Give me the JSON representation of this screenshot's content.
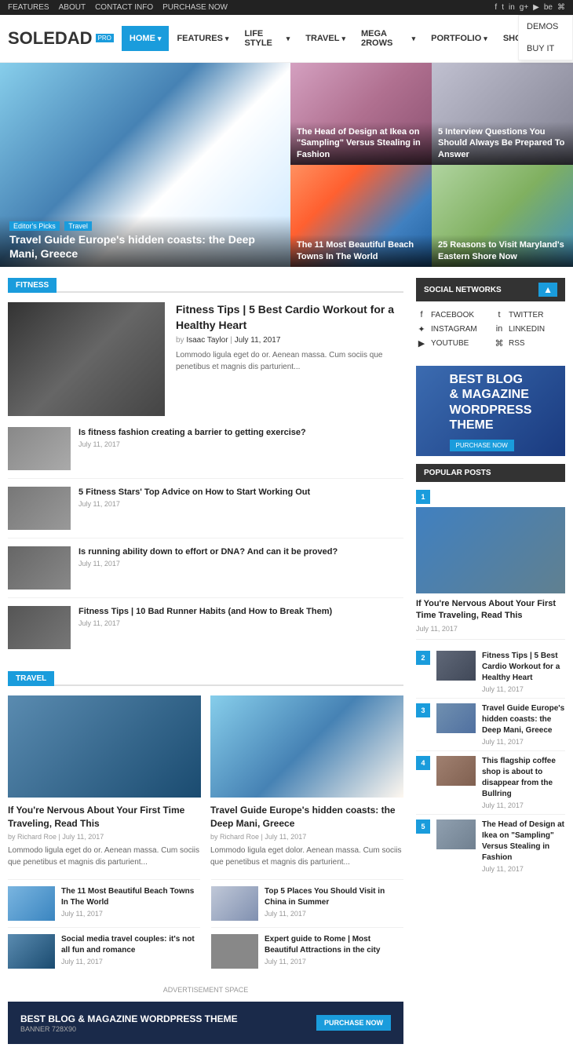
{
  "topbar": {
    "links": [
      "FEATURES",
      "ABOUT",
      "CONTACT INFO",
      "PURCHASE NOW"
    ],
    "social_icons": [
      "f",
      "t",
      "in",
      "g+",
      "y",
      "be",
      "rss"
    ]
  },
  "header": {
    "logo": "SOLEDAD",
    "logo_badge": "PRO",
    "nav_items": [
      "HOME",
      "FEATURES",
      "LIFE STYLE",
      "TRAVEL",
      "MEGA 2ROWS",
      "PORTFOLIO",
      "SHOP"
    ],
    "dropdown": [
      "DEMOS",
      "BUY IT"
    ]
  },
  "hero": {
    "main": {
      "tag1": "Editor's Picks",
      "tag2": "Travel",
      "title": "Travel Guide Europe's hidden coasts: the Deep Mani, Greece"
    },
    "cards": [
      {
        "title": "The Head of Design at Ikea on \"Sampling\" Versus Stealing in Fashion"
      },
      {
        "title": "5 Interview Questions You Should Always Be Prepared To Answer"
      },
      {
        "title": "The 11 Most Beautiful Beach Towns In The World"
      },
      {
        "title": "25 Reasons to Visit Maryland's Eastern Shore Now"
      }
    ]
  },
  "fitness": {
    "section_label": "FITNESS",
    "featured": {
      "title": "Fitness Tips | 5 Best Cardio Workout for a Healthy Heart",
      "author": "Isaac Taylor",
      "date": "July 11, 2017",
      "excerpt": "Lommodo ligula eget do or. Aenean massa. Cum sociis que penetibus et magnis dis parturient..."
    },
    "list": [
      {
        "title": "Is fitness fashion creating a barrier to getting exercise?",
        "date": "July 11, 2017"
      },
      {
        "title": "5 Fitness Stars' Top Advice on How to Start Working Out",
        "date": "July 11, 2017"
      },
      {
        "title": "Is running ability down to effort or DNA? And can it be proved?",
        "date": "July 11, 2017"
      },
      {
        "title": "Fitness Tips | 10 Bad Runner Habits (and How to Break Them)",
        "date": "July 11, 2017"
      }
    ]
  },
  "travel": {
    "section_label": "TRAVEL",
    "featured": [
      {
        "title": "If You're Nervous About Your First Time Traveling, Read This",
        "author": "Richard Roe",
        "date": "July 11, 2017",
        "excerpt": "Lommodo ligula eget do or. Aenean massa. Cum sociis que penetibus et magnis dis parturient..."
      },
      {
        "title": "Travel Guide Europe's hidden coasts: the Deep Mani, Greece",
        "author": "Richard Roe",
        "date": "July 11, 2017",
        "excerpt": "Lommodo ligula eget dolor. Aenean massa. Cum sociis que penetibus et magnis dis parturient..."
      }
    ],
    "list": [
      {
        "title": "The 11 Most Beautiful Beach Towns In The World",
        "date": "July 11, 2017"
      },
      {
        "title": "Top 5 Places You Should Visit in China in Summer",
        "date": "July 11, 2017"
      },
      {
        "title": "Social media travel couples: it's not all fun and romance",
        "date": "July 11, 2017"
      },
      {
        "title": "Expert guide to Rome | Most Beautiful Attractions in the city",
        "date": "July 11, 2017"
      }
    ]
  },
  "ad_banner": {
    "label": "ADVERTISEMENT SPACE",
    "title": "BEST BLOG & MAGAZINE WORDPRESS THEME",
    "sub": "BANNER 728X90",
    "button": "PURCHASE NOW"
  },
  "sidebar": {
    "social_title": "SOCIAL NETWORKS",
    "social_items": [
      {
        "icon": "f",
        "label": "FACEBOOK",
        "side": "left"
      },
      {
        "icon": "t",
        "label": "TWITTER",
        "side": "right"
      },
      {
        "icon": "in",
        "label": "INSTAGRAM",
        "side": "left"
      },
      {
        "icon": "li",
        "label": "LINKEDIN",
        "side": "right"
      },
      {
        "icon": "yt",
        "label": "YOUTUBE",
        "side": "left"
      },
      {
        "icon": "rss",
        "label": "RSS",
        "side": "right"
      }
    ],
    "sidebar_ad": {
      "line1": "BEST BLOG",
      "line2": "& MAGAZINE",
      "line3": "WORDPRESS",
      "line4": "THEME",
      "button": "PURCHASE NOW"
    },
    "popular_title": "POPULAR POSTS",
    "popular": [
      {
        "num": "1",
        "title": "If You're Nervous About Your First Time Traveling, Read This",
        "date": "July 11, 2017",
        "featured": true
      },
      {
        "num": "2",
        "title": "Fitness Tips | 5 Best Cardio Workout for a Healthy Heart",
        "date": "July 11, 2017",
        "featured": false
      },
      {
        "num": "3",
        "title": "Travel Guide Europe's hidden coasts: the Deep Mani, Greece",
        "date": "July 11, 2017",
        "featured": false
      },
      {
        "num": "4",
        "title": "This flagship coffee shop is about to disappear from the Bullring",
        "date": "July 11, 2017",
        "featured": false
      },
      {
        "num": "5",
        "title": "The Head of Design at Ikea on \"Sampling\" Versus Stealing in Fashion",
        "date": "July 11, 2017",
        "featured": false
      }
    ]
  }
}
